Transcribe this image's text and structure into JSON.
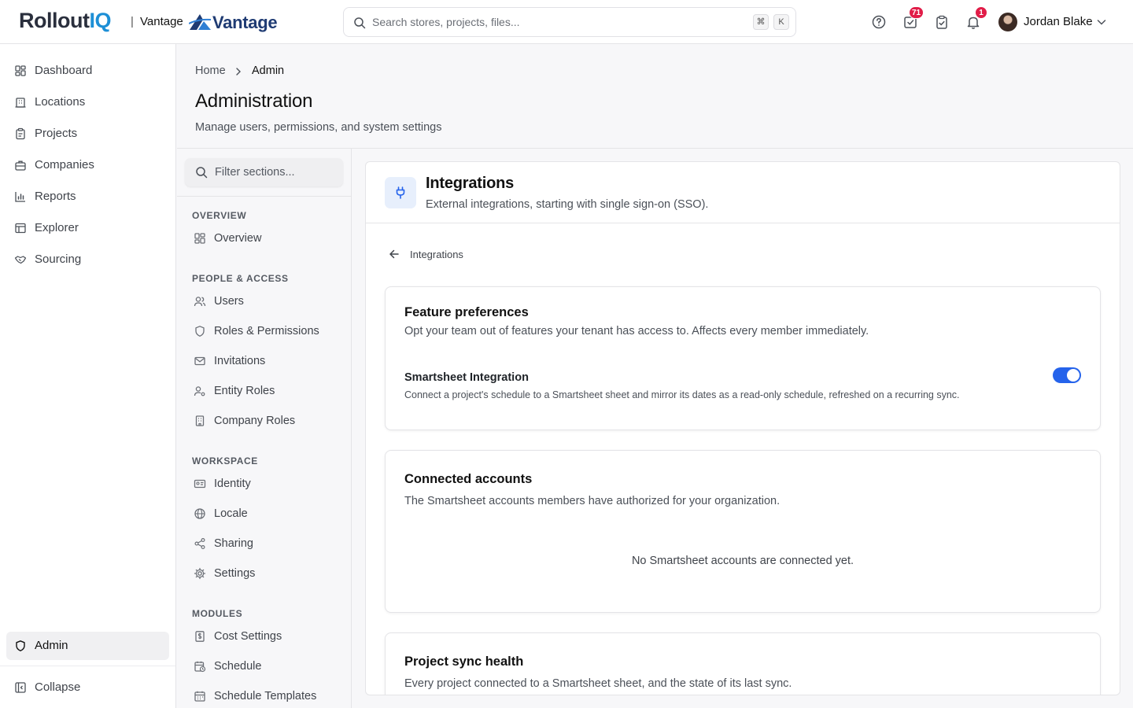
{
  "app": {
    "logo_main": "Rollout",
    "logo_accent": "IQ",
    "separator": "|",
    "tenant": "Vantage",
    "brand": "Vantage"
  },
  "search": {
    "placeholder": "Search stores, projects, files...",
    "shortcut_mod": "⌘",
    "shortcut_key": "K"
  },
  "header": {
    "tasks_count": "71",
    "notifications_count": "1",
    "user_name": "Jordan Blake"
  },
  "leftnav": {
    "items": [
      {
        "label": "Dashboard",
        "icon": "dashboard-icon"
      },
      {
        "label": "Locations",
        "icon": "building-icon"
      },
      {
        "label": "Projects",
        "icon": "clipboard-icon"
      },
      {
        "label": "Companies",
        "icon": "briefcase-icon"
      },
      {
        "label": "Reports",
        "icon": "bar-chart-icon"
      },
      {
        "label": "Explorer",
        "icon": "table-icon"
      },
      {
        "label": "Sourcing",
        "icon": "handshake-icon"
      }
    ],
    "admin_label": "Admin",
    "collapse_label": "Collapse"
  },
  "page": {
    "breadcrumb_home": "Home",
    "breadcrumb_current": "Admin",
    "title": "Administration",
    "subtitle": "Manage users, permissions, and system settings"
  },
  "sections": {
    "filter_placeholder": "Filter sections...",
    "groups": [
      {
        "label": "OVERVIEW",
        "items": [
          "Overview"
        ]
      },
      {
        "label": "PEOPLE & ACCESS",
        "items": [
          "Users",
          "Roles & Permissions",
          "Invitations",
          "Entity Roles",
          "Company Roles"
        ]
      },
      {
        "label": "WORKSPACE",
        "items": [
          "Identity",
          "Locale",
          "Sharing",
          "Settings"
        ]
      },
      {
        "label": "MODULES",
        "items": [
          "Cost Settings",
          "Schedule",
          "Schedule Templates"
        ]
      }
    ]
  },
  "panel": {
    "title": "Integrations",
    "subtitle": "External integrations, starting with single sign-on (SSO).",
    "back_label": "Integrations",
    "feature_card": {
      "title": "Feature preferences",
      "subtitle": "Opt your team out of features your tenant has access to. Affects every member immediately.",
      "feature_name": "Smartsheet Integration",
      "feature_desc": "Connect a project's schedule to a Smartsheet sheet and mirror its dates as a read-only schedule, refreshed on a recurring sync.",
      "enabled": true
    },
    "accounts_card": {
      "title": "Connected accounts",
      "subtitle": "The Smartsheet accounts members have authorized for your organization.",
      "empty": "No Smartsheet accounts are connected yet."
    },
    "sync_card": {
      "title": "Project sync health",
      "subtitle": "Every project connected to a Smartsheet sheet, and the state of its last sync."
    }
  },
  "colors": {
    "accent": "#2563eb",
    "badge": "#e11d48",
    "logo_accent": "#1d8fd6",
    "brand": "#1f3b73"
  }
}
